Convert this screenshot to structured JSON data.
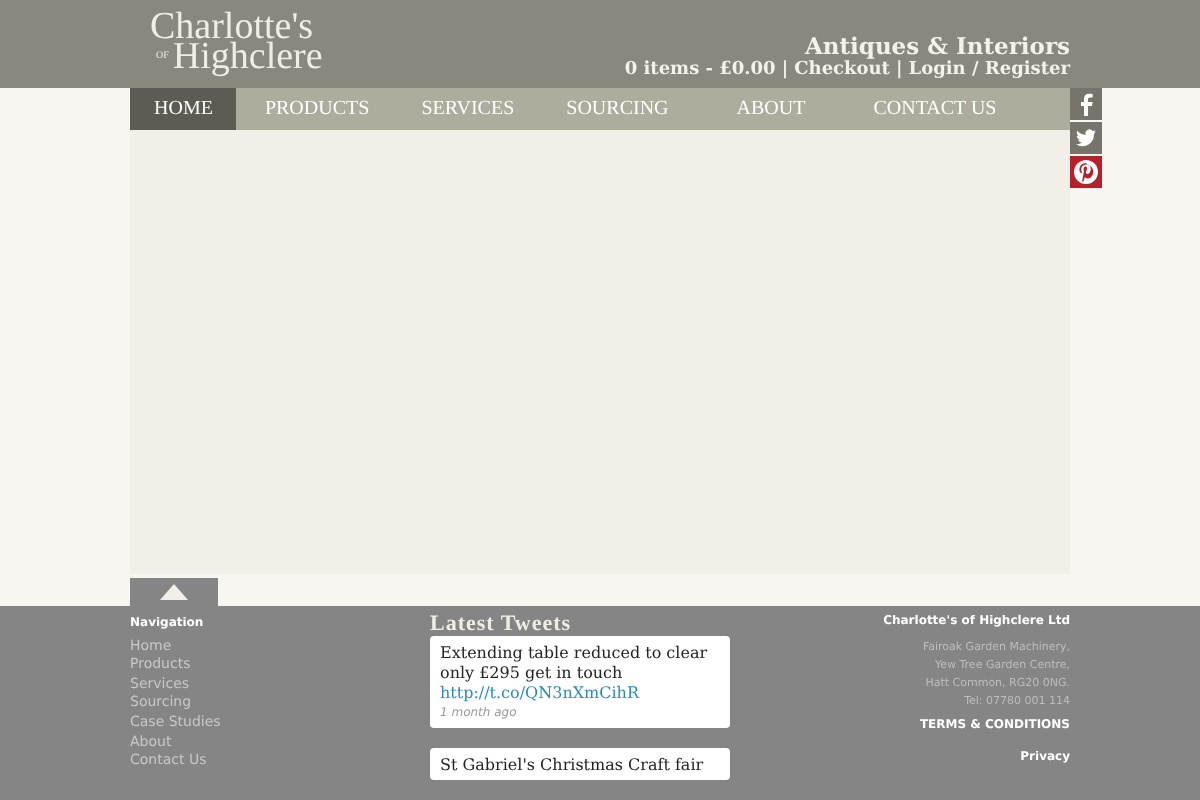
{
  "logo": {
    "line1": "Charlotte's",
    "of": "OF",
    "line2": "Highclere"
  },
  "header": {
    "tagline": "Antiques & Interiors",
    "cart": "0 items - £0.00",
    "separator": "|",
    "links": [
      "Checkout",
      "Login / Register"
    ]
  },
  "nav": [
    {
      "label": "HOME",
      "selected": true
    },
    {
      "label": "PRODUCTS",
      "selected": false
    },
    {
      "label": "SERVICES",
      "selected": false
    },
    {
      "label": "SOURCING",
      "selected": false
    },
    {
      "label": "ABOUT",
      "selected": false
    },
    {
      "label": "CONTACT US",
      "selected": false
    }
  ],
  "social": [
    {
      "kind": "facebook"
    },
    {
      "kind": "twitter"
    },
    {
      "kind": "pinterest"
    }
  ],
  "footer": {
    "navigation": {
      "title": "Navigation",
      "items": [
        "Home",
        "Products",
        "Services",
        "Sourcing",
        "Case Studies",
        "About",
        "Contact Us"
      ]
    },
    "tweets": {
      "title": "Latest Tweets",
      "items": [
        {
          "text": "Extending table reduced to clear only £295 get in touch",
          "link": "http://t.co/QN3nXmCihR",
          "time": "1 month ago"
        },
        {
          "text": "St Gabriel's Christmas Craft fair"
        }
      ]
    },
    "company": {
      "title": "Charlotte's of Highclere Ltd",
      "address": [
        "Fairoak Garden Machinery,",
        "Yew Tree Garden Centre,",
        "Hatt Common, RG20 0NG.",
        "Tel: 07780 001 114"
      ],
      "links": [
        "TERMS & CONDITIONS",
        "Privacy"
      ]
    }
  }
}
